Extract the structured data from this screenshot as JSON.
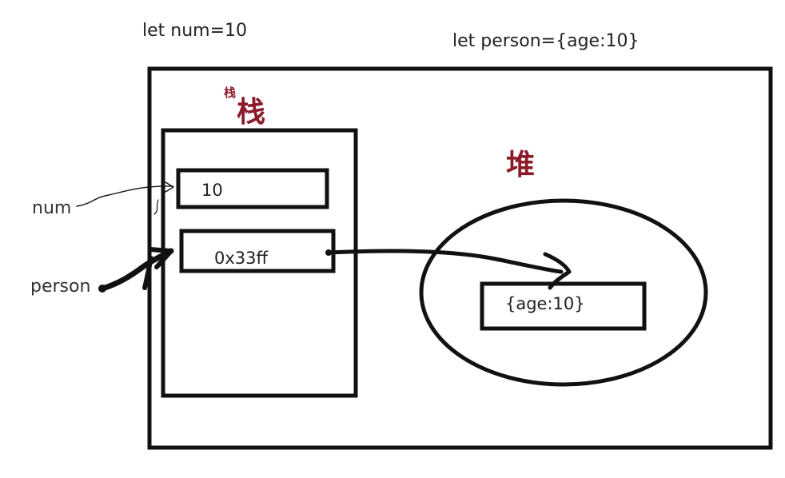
{
  "code": {
    "num_decl": "let num=10",
    "person_decl": "let person={age:10}"
  },
  "stack": {
    "title": "栈",
    "title_small": "栈",
    "slot_num_value": "10",
    "slot_person_value": "0x33ff"
  },
  "heap": {
    "title": "堆",
    "object_value": "{age:10}"
  },
  "labels": {
    "num": "num",
    "person": "person"
  },
  "colors": {
    "title_red": "#8b1a2a",
    "ink": "#111111"
  }
}
